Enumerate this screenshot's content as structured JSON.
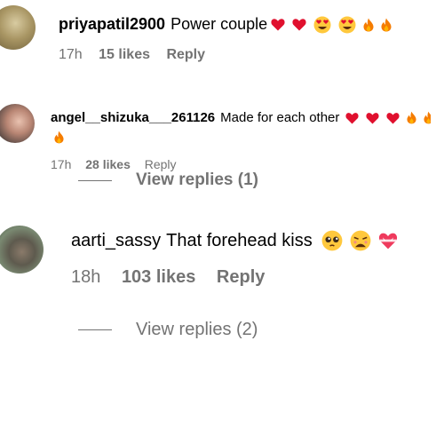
{
  "comments": [
    {
      "username": "priyapatil2900",
      "text": "Power couple",
      "emojis": [
        "red-heart",
        "red-heart",
        "heart-eyes-face",
        "heart-eyes-face",
        "fire",
        "fire"
      ],
      "time": "17h",
      "likes": "15 likes",
      "reply": "Reply"
    },
    {
      "username": "angel__shizuka___261126",
      "text": "Made for each other",
      "emojis": [
        "red-heart",
        "red-heart",
        "red-heart",
        "fire",
        "fire",
        "fire"
      ],
      "time": "17h",
      "likes": "28 likes",
      "reply": "Reply",
      "view_replies": "View replies (1)"
    },
    {
      "username": "aarti_sassy",
      "text": "That forehead kiss",
      "emojis": [
        "pleading-face",
        "weary-face",
        "heart-with-ribbon"
      ],
      "time": "18h",
      "likes": "103 likes",
      "reply": "Reply",
      "view_replies": "View replies (2)"
    }
  ],
  "colors": {
    "secondary_text": "#737373",
    "heart": "#e0102e",
    "flame": "#f57c00",
    "face": "#ffc83d"
  }
}
